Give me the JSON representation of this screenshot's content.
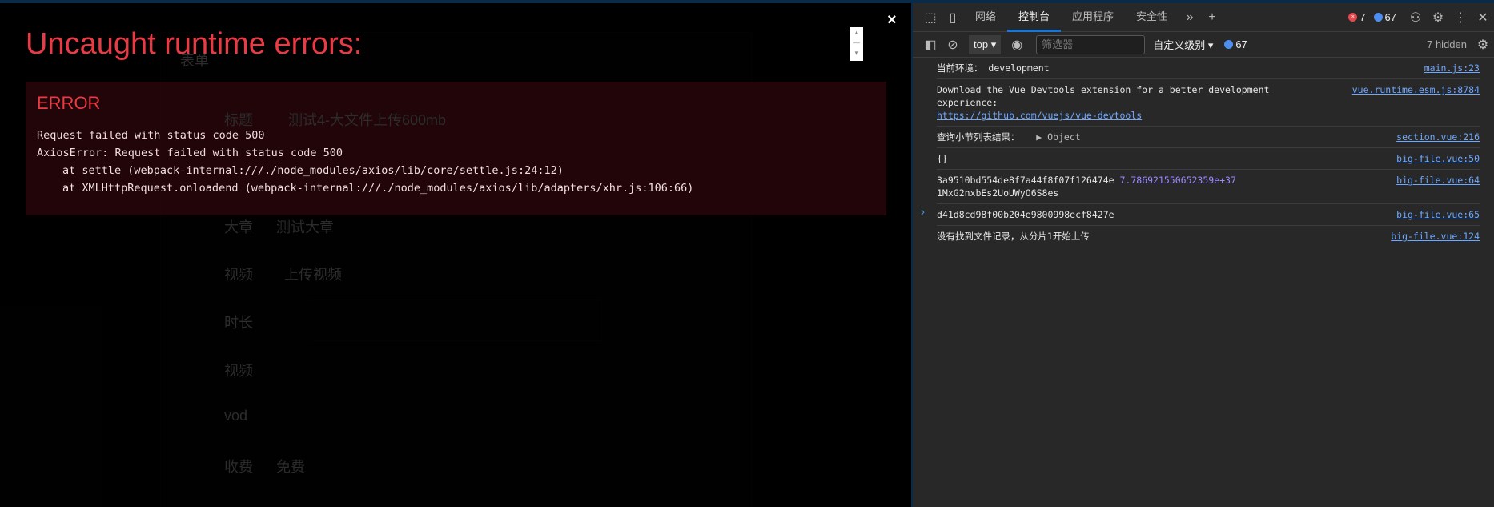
{
  "background_app": {
    "form_title": "表单",
    "fields": [
      "标题",
      "测试4-大文件上传600mb",
      "大章",
      "测试大章",
      "视频",
      "上传视频",
      "时长",
      "视频",
      "vod",
      "收费",
      "免费"
    ]
  },
  "overlay": {
    "title": "Uncaught runtime errors:",
    "close_label": "×",
    "error_label": "ERROR",
    "lines": [
      "Request failed with status code 500",
      "AxiosError: Request failed with status code 500",
      "at settle (webpack-internal:///./node_modules/axios/lib/core/settle.js:24:12)",
      "at XMLHttpRequest.onloadend (webpack-internal:///./node_modules/axios/lib/adapters/xhr.js:106:66)"
    ]
  },
  "devtools": {
    "tabs": [
      "网络",
      "控制台",
      "应用程序",
      "安全性"
    ],
    "active_tab": "控制台",
    "error_count": "7",
    "message_count": "67",
    "context": "top",
    "filter_placeholder": "筛选器",
    "level": "自定义级别",
    "bar_message_count": "67",
    "hidden": "7 hidden",
    "colors": {
      "accent": "#1a76d2",
      "error": "#e5484d",
      "info": "#4d8ff0"
    },
    "messages": [
      {
        "text": "当前环境： development",
        "source": "main.js:23"
      },
      {
        "text": "Download the Vue Devtools extension for a better development experience:",
        "link": "https://github.com/vuejs/vue-devtools",
        "source": "vue.runtime.esm.js:8784"
      },
      {
        "text": "查询小节列表结果：",
        "object": "▶ Object",
        "source": "section.vue:216"
      },
      {
        "text": "{}",
        "source": "big-file.vue:50"
      },
      {
        "text": "3a9510bd554de8f7a44f8f07f126474e",
        "number": "7.786921550652359e+37",
        "text2": "1MxG2nxbEs2UoUWyO6S8es",
        "source": "big-file.vue:64"
      },
      {
        "text": "d41d8cd98f00b204e9800998ecf8427e",
        "source": "big-file.vue:65"
      },
      {
        "text": "没有找到文件记录，从分片1开始上传",
        "source": "big-file.vue:124"
      }
    ]
  }
}
